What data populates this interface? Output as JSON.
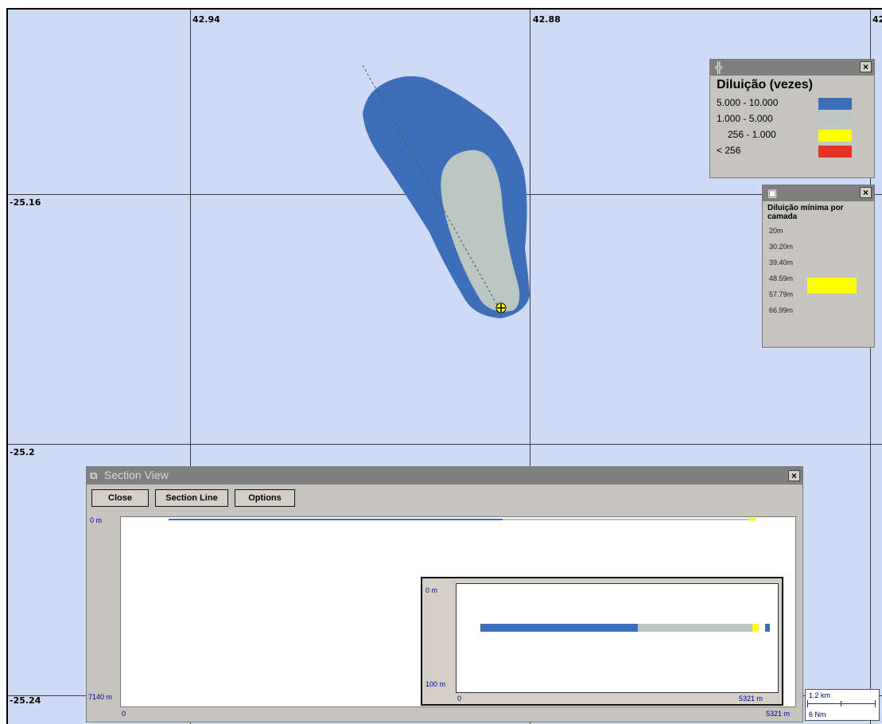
{
  "map": {
    "lon_labels": [
      "42.94",
      "42.88",
      "42"
    ],
    "lat_labels": [
      "-25.16",
      "-25.2",
      "-25.24"
    ]
  },
  "legend_dilution": {
    "title": "Diluição (vezes)",
    "rows": [
      {
        "label": "5.000 - 10.000",
        "color": "#3d6fb9"
      },
      {
        "label": "1.000 - 5.000",
        "color": "#b9c6c1"
      },
      {
        "label": "256 - 1.000",
        "color": "#ffff00"
      },
      {
        "label": "< 256",
        "color": "#e33324"
      }
    ],
    "close_label": "×"
  },
  "legend_layers": {
    "title": "Diluição mínima por camada",
    "rows": [
      "20m",
      "30.20m",
      "39.40m",
      "48.59m",
      "57.79m",
      "66.99m"
    ],
    "swatch_color": "#ffff00",
    "close_label": "×"
  },
  "section_view": {
    "title": "Section View",
    "close_x": "×",
    "buttons": {
      "close": "Close",
      "section_line": "Section Line",
      "options": "Options"
    },
    "plot": {
      "y_top": "0 m",
      "y_bottom": "7140 m",
      "x_left": "0",
      "x_right": "5321 m"
    },
    "inset": {
      "y_top": "0 m",
      "y_bottom": "100 m",
      "x_left": "0",
      "x_right": "5321 m"
    }
  },
  "scale_bar": {
    "km": "1.2 km",
    "nm": "6 Nm"
  },
  "colors": {
    "map_bg": "#cfdaf7",
    "plume_outer": "#3d6fb9",
    "plume_inner": "#b9c6c1",
    "marker": "#ffff00"
  }
}
